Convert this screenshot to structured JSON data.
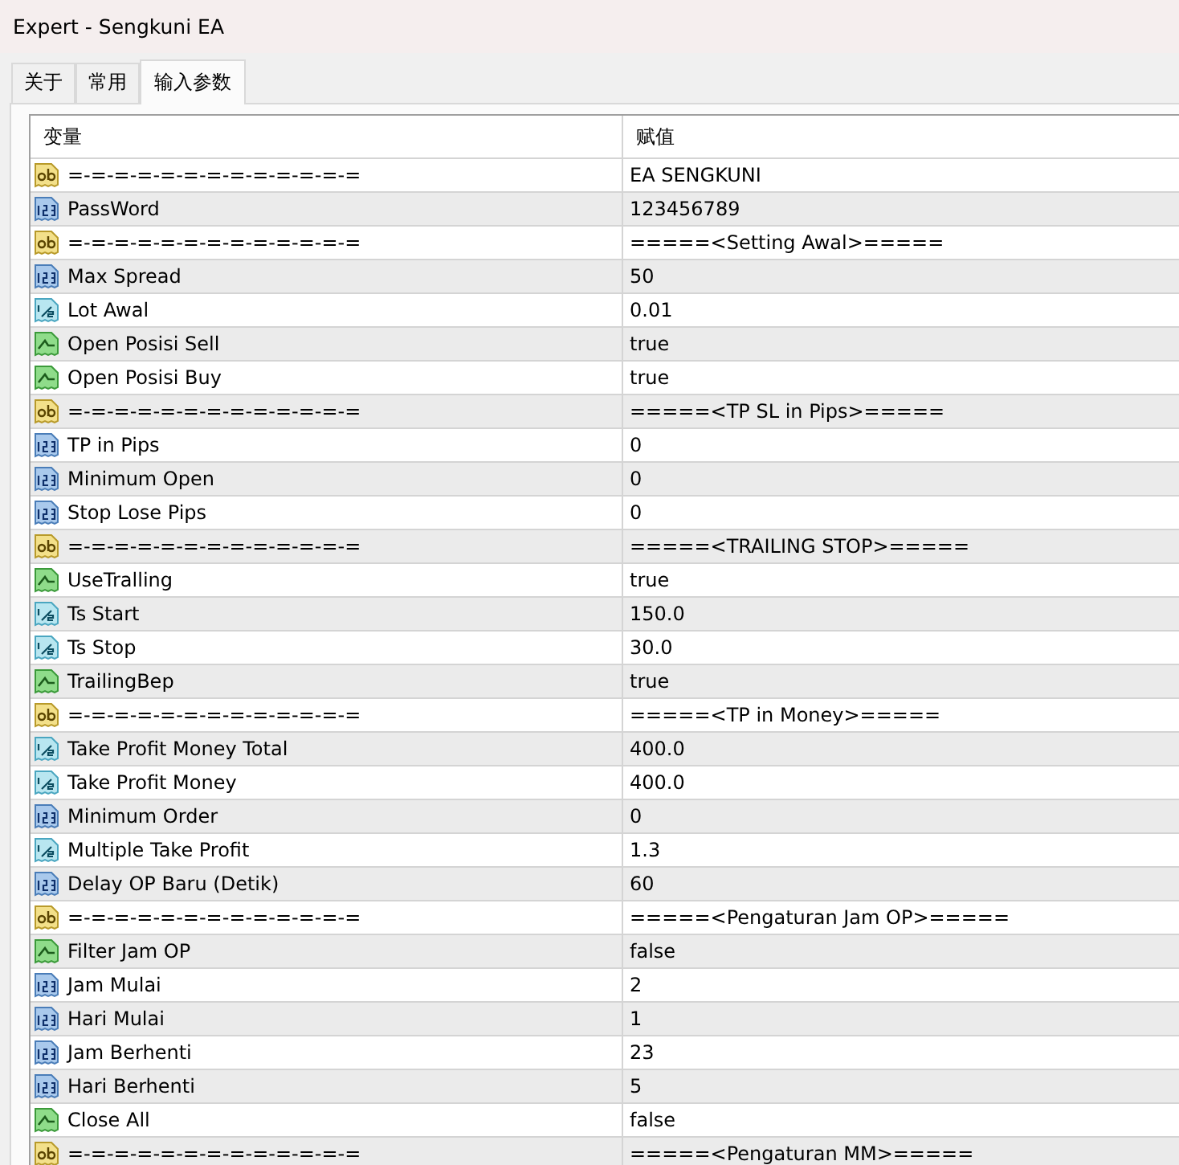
{
  "window": {
    "title": "Expert - Sengkuni EA"
  },
  "tabs": [
    {
      "label": "关于",
      "selected": false
    },
    {
      "label": "常用",
      "selected": false
    },
    {
      "label": "输入参数",
      "selected": true
    }
  ],
  "table": {
    "columns": [
      "变量",
      "赋值"
    ],
    "rows": [
      {
        "kind": "string",
        "name": "=-=-=-=-=-=-=-=-=-=-=-=-=",
        "value": "EA SENGKUNI"
      },
      {
        "kind": "int",
        "name": "PassWord",
        "value": "123456789"
      },
      {
        "kind": "string",
        "name": "=-=-=-=-=-=-=-=-=-=-=-=-=",
        "value": "=====<Setting Awal>====="
      },
      {
        "kind": "int",
        "name": "Max Spread",
        "value": "50"
      },
      {
        "kind": "double",
        "name": "Lot Awal",
        "value": "0.01"
      },
      {
        "kind": "bool",
        "name": "Open Posisi Sell",
        "value": "true"
      },
      {
        "kind": "bool",
        "name": "Open Posisi Buy",
        "value": "true"
      },
      {
        "kind": "string",
        "name": "=-=-=-=-=-=-=-=-=-=-=-=-=",
        "value": "=====<TP SL in Pips>====="
      },
      {
        "kind": "int",
        "name": "TP in Pips",
        "value": "0"
      },
      {
        "kind": "int",
        "name": "Minimum Open",
        "value": "0"
      },
      {
        "kind": "int",
        "name": "Stop Lose Pips",
        "value": "0"
      },
      {
        "kind": "string",
        "name": "=-=-=-=-=-=-=-=-=-=-=-=-=",
        "value": "=====<TRAILING STOP>====="
      },
      {
        "kind": "bool",
        "name": "UseTralling",
        "value": "true"
      },
      {
        "kind": "double",
        "name": "Ts Start",
        "value": "150.0"
      },
      {
        "kind": "double",
        "name": "Ts Stop",
        "value": "30.0"
      },
      {
        "kind": "bool",
        "name": "TrailingBep",
        "value": "true"
      },
      {
        "kind": "string",
        "name": "=-=-=-=-=-=-=-=-=-=-=-=-=",
        "value": "=====<TP in Money>====="
      },
      {
        "kind": "double",
        "name": "Take Profit Money Total",
        "value": "400.0"
      },
      {
        "kind": "double",
        "name": "Take Profit Money",
        "value": "400.0"
      },
      {
        "kind": "int",
        "name": "Minimum Order",
        "value": "0"
      },
      {
        "kind": "double",
        "name": "Multiple Take Profit",
        "value": "1.3"
      },
      {
        "kind": "int",
        "name": "Delay OP Baru (Detik)",
        "value": "60"
      },
      {
        "kind": "string",
        "name": "=-=-=-=-=-=-=-=-=-=-=-=-=",
        "value": "=====<Pengaturan Jam OP>====="
      },
      {
        "kind": "bool",
        "name": "Filter Jam OP",
        "value": "false"
      },
      {
        "kind": "int",
        "name": "Jam Mulai",
        "value": "2"
      },
      {
        "kind": "int",
        "name": "Hari Mulai",
        "value": "1"
      },
      {
        "kind": "int",
        "name": "Jam Berhenti",
        "value": "23"
      },
      {
        "kind": "int",
        "name": "Hari Berhenti",
        "value": "5"
      },
      {
        "kind": "bool",
        "name": "Close All",
        "value": "false"
      },
      {
        "kind": "string",
        "name": "=-=-=-=-=-=-=-=-=-=-=-=-=",
        "value": "=====<Pengaturan MM>====="
      }
    ]
  }
}
